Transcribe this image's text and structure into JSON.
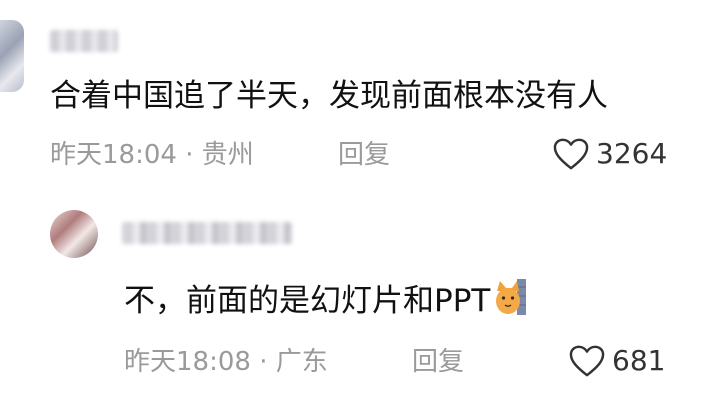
{
  "comments": [
    {
      "text": "合着中国追了半天，发现前面根本没有人",
      "time_location": "昨天18:04 · 贵州",
      "reply_label": "回复",
      "likes": "3264"
    },
    {
      "text": "不，前面的是幻灯片和PPT",
      "time_location": "昨天18:08 · 广东",
      "reply_label": "回复",
      "likes": "681",
      "sticker": "cat-sticker-icon"
    }
  ],
  "icons": {
    "like": "heart-icon"
  },
  "colors": {
    "meta_text": "#9a9a9a",
    "body_text": "#111111",
    "like_count": "#333333"
  }
}
